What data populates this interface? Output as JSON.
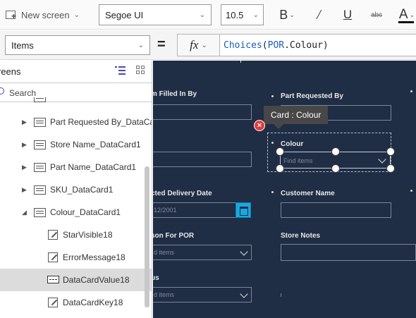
{
  "ribbon": {
    "new_screen_label": "New screen",
    "font_family": "Segoe UI",
    "font_size": "10.5",
    "bold_glyph": "B",
    "italic_glyph": "/",
    "underline_glyph": "U",
    "strikethrough_glyph": "abc",
    "font_color_glyph": "A"
  },
  "formula_bar": {
    "property": "Items",
    "equals": "=",
    "fx_label": "fx",
    "formula_fn": "Choices",
    "formula_open": "(",
    "formula_obj": "POR",
    "formula_rest": ".Colour)"
  },
  "tree": {
    "title": "reens",
    "search_placeholder": "Search",
    "items": [
      {
        "label": "Part Requested By_DataCard1",
        "icon": "card-icon",
        "level": 1,
        "caret": "right"
      },
      {
        "label": "Store Name_DataCard1",
        "icon": "card-icon",
        "level": 1,
        "caret": "right"
      },
      {
        "label": "Part Name_DataCard1",
        "icon": "card-icon",
        "level": 1,
        "caret": "right"
      },
      {
        "label": "SKU_DataCard1",
        "icon": "card-icon",
        "level": 1,
        "caret": "right"
      },
      {
        "label": "Colour_DataCard1",
        "icon": "card-icon",
        "level": 1,
        "caret": "down"
      },
      {
        "label": "StarVisible18",
        "icon": "edit-icon",
        "level": 2
      },
      {
        "label": "ErrorMessage18",
        "icon": "edit-icon",
        "level": 2
      },
      {
        "label": "DataCardValue18",
        "icon": "input-icon",
        "level": 2,
        "selected": true
      },
      {
        "label": "DataCardKey18",
        "icon": "edit-icon",
        "level": 2
      }
    ]
  },
  "canvas": {
    "tooltip": "Card : Colour",
    "labels": {
      "filled_in_by": "m Filled In By",
      "part_requested_by": "Part Requested By",
      "colour": "Colour",
      "expected_delivery": "cted Delivery Date",
      "customer_name": "Customer Name",
      "reason": "son For POR",
      "store_notes": "Store Notes",
      "status": "us"
    },
    "date_value": "12/2001",
    "find_items": "Find items",
    "find_items_short": "d items"
  }
}
